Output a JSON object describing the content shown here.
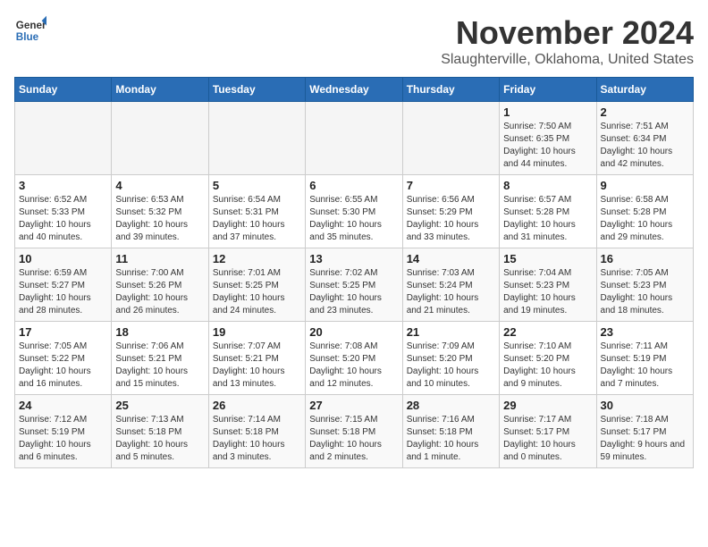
{
  "logo": {
    "line1": "General",
    "line2": "Blue"
  },
  "title": "November 2024",
  "location": "Slaughterville, Oklahoma, United States",
  "days_of_week": [
    "Sunday",
    "Monday",
    "Tuesday",
    "Wednesday",
    "Thursday",
    "Friday",
    "Saturday"
  ],
  "weeks": [
    [
      {
        "day": "",
        "info": ""
      },
      {
        "day": "",
        "info": ""
      },
      {
        "day": "",
        "info": ""
      },
      {
        "day": "",
        "info": ""
      },
      {
        "day": "",
        "info": ""
      },
      {
        "day": "1",
        "info": "Sunrise: 7:50 AM\nSunset: 6:35 PM\nDaylight: 10 hours and 44 minutes."
      },
      {
        "day": "2",
        "info": "Sunrise: 7:51 AM\nSunset: 6:34 PM\nDaylight: 10 hours and 42 minutes."
      }
    ],
    [
      {
        "day": "3",
        "info": "Sunrise: 6:52 AM\nSunset: 5:33 PM\nDaylight: 10 hours and 40 minutes."
      },
      {
        "day": "4",
        "info": "Sunrise: 6:53 AM\nSunset: 5:32 PM\nDaylight: 10 hours and 39 minutes."
      },
      {
        "day": "5",
        "info": "Sunrise: 6:54 AM\nSunset: 5:31 PM\nDaylight: 10 hours and 37 minutes."
      },
      {
        "day": "6",
        "info": "Sunrise: 6:55 AM\nSunset: 5:30 PM\nDaylight: 10 hours and 35 minutes."
      },
      {
        "day": "7",
        "info": "Sunrise: 6:56 AM\nSunset: 5:29 PM\nDaylight: 10 hours and 33 minutes."
      },
      {
        "day": "8",
        "info": "Sunrise: 6:57 AM\nSunset: 5:28 PM\nDaylight: 10 hours and 31 minutes."
      },
      {
        "day": "9",
        "info": "Sunrise: 6:58 AM\nSunset: 5:28 PM\nDaylight: 10 hours and 29 minutes."
      }
    ],
    [
      {
        "day": "10",
        "info": "Sunrise: 6:59 AM\nSunset: 5:27 PM\nDaylight: 10 hours and 28 minutes."
      },
      {
        "day": "11",
        "info": "Sunrise: 7:00 AM\nSunset: 5:26 PM\nDaylight: 10 hours and 26 minutes."
      },
      {
        "day": "12",
        "info": "Sunrise: 7:01 AM\nSunset: 5:25 PM\nDaylight: 10 hours and 24 minutes."
      },
      {
        "day": "13",
        "info": "Sunrise: 7:02 AM\nSunset: 5:25 PM\nDaylight: 10 hours and 23 minutes."
      },
      {
        "day": "14",
        "info": "Sunrise: 7:03 AM\nSunset: 5:24 PM\nDaylight: 10 hours and 21 minutes."
      },
      {
        "day": "15",
        "info": "Sunrise: 7:04 AM\nSunset: 5:23 PM\nDaylight: 10 hours and 19 minutes."
      },
      {
        "day": "16",
        "info": "Sunrise: 7:05 AM\nSunset: 5:23 PM\nDaylight: 10 hours and 18 minutes."
      }
    ],
    [
      {
        "day": "17",
        "info": "Sunrise: 7:05 AM\nSunset: 5:22 PM\nDaylight: 10 hours and 16 minutes."
      },
      {
        "day": "18",
        "info": "Sunrise: 7:06 AM\nSunset: 5:21 PM\nDaylight: 10 hours and 15 minutes."
      },
      {
        "day": "19",
        "info": "Sunrise: 7:07 AM\nSunset: 5:21 PM\nDaylight: 10 hours and 13 minutes."
      },
      {
        "day": "20",
        "info": "Sunrise: 7:08 AM\nSunset: 5:20 PM\nDaylight: 10 hours and 12 minutes."
      },
      {
        "day": "21",
        "info": "Sunrise: 7:09 AM\nSunset: 5:20 PM\nDaylight: 10 hours and 10 minutes."
      },
      {
        "day": "22",
        "info": "Sunrise: 7:10 AM\nSunset: 5:20 PM\nDaylight: 10 hours and 9 minutes."
      },
      {
        "day": "23",
        "info": "Sunrise: 7:11 AM\nSunset: 5:19 PM\nDaylight: 10 hours and 7 minutes."
      }
    ],
    [
      {
        "day": "24",
        "info": "Sunrise: 7:12 AM\nSunset: 5:19 PM\nDaylight: 10 hours and 6 minutes."
      },
      {
        "day": "25",
        "info": "Sunrise: 7:13 AM\nSunset: 5:18 PM\nDaylight: 10 hours and 5 minutes."
      },
      {
        "day": "26",
        "info": "Sunrise: 7:14 AM\nSunset: 5:18 PM\nDaylight: 10 hours and 3 minutes."
      },
      {
        "day": "27",
        "info": "Sunrise: 7:15 AM\nSunset: 5:18 PM\nDaylight: 10 hours and 2 minutes."
      },
      {
        "day": "28",
        "info": "Sunrise: 7:16 AM\nSunset: 5:18 PM\nDaylight: 10 hours and 1 minute."
      },
      {
        "day": "29",
        "info": "Sunrise: 7:17 AM\nSunset: 5:17 PM\nDaylight: 10 hours and 0 minutes."
      },
      {
        "day": "30",
        "info": "Sunrise: 7:18 AM\nSunset: 5:17 PM\nDaylight: 9 hours and 59 minutes."
      }
    ]
  ]
}
